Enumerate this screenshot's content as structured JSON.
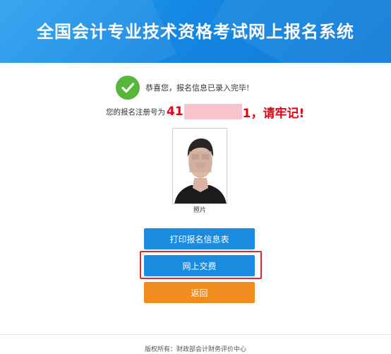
{
  "header": {
    "title": "全国会计专业技术资格考试网上报名系统"
  },
  "result": {
    "icon": "check-circle-icon",
    "icon_color": "#58b63a",
    "message": "恭喜您，报名信息已录入完毕!"
  },
  "registration": {
    "label": "您的报名注册号为",
    "number_prefix": "41",
    "number_suffix": "1，请牢记!",
    "accent_color": "#e60012"
  },
  "photo": {
    "caption": "照片"
  },
  "actions": {
    "print_label": "打印报名信息表",
    "pay_label": "网上交费",
    "back_label": "返回",
    "primary_color": "#1b8be0",
    "back_color": "#f18d1f",
    "highlight_color": "#e02b2b"
  },
  "footer": {
    "copyright": "版权所有：财政部会计财务评价中心"
  }
}
